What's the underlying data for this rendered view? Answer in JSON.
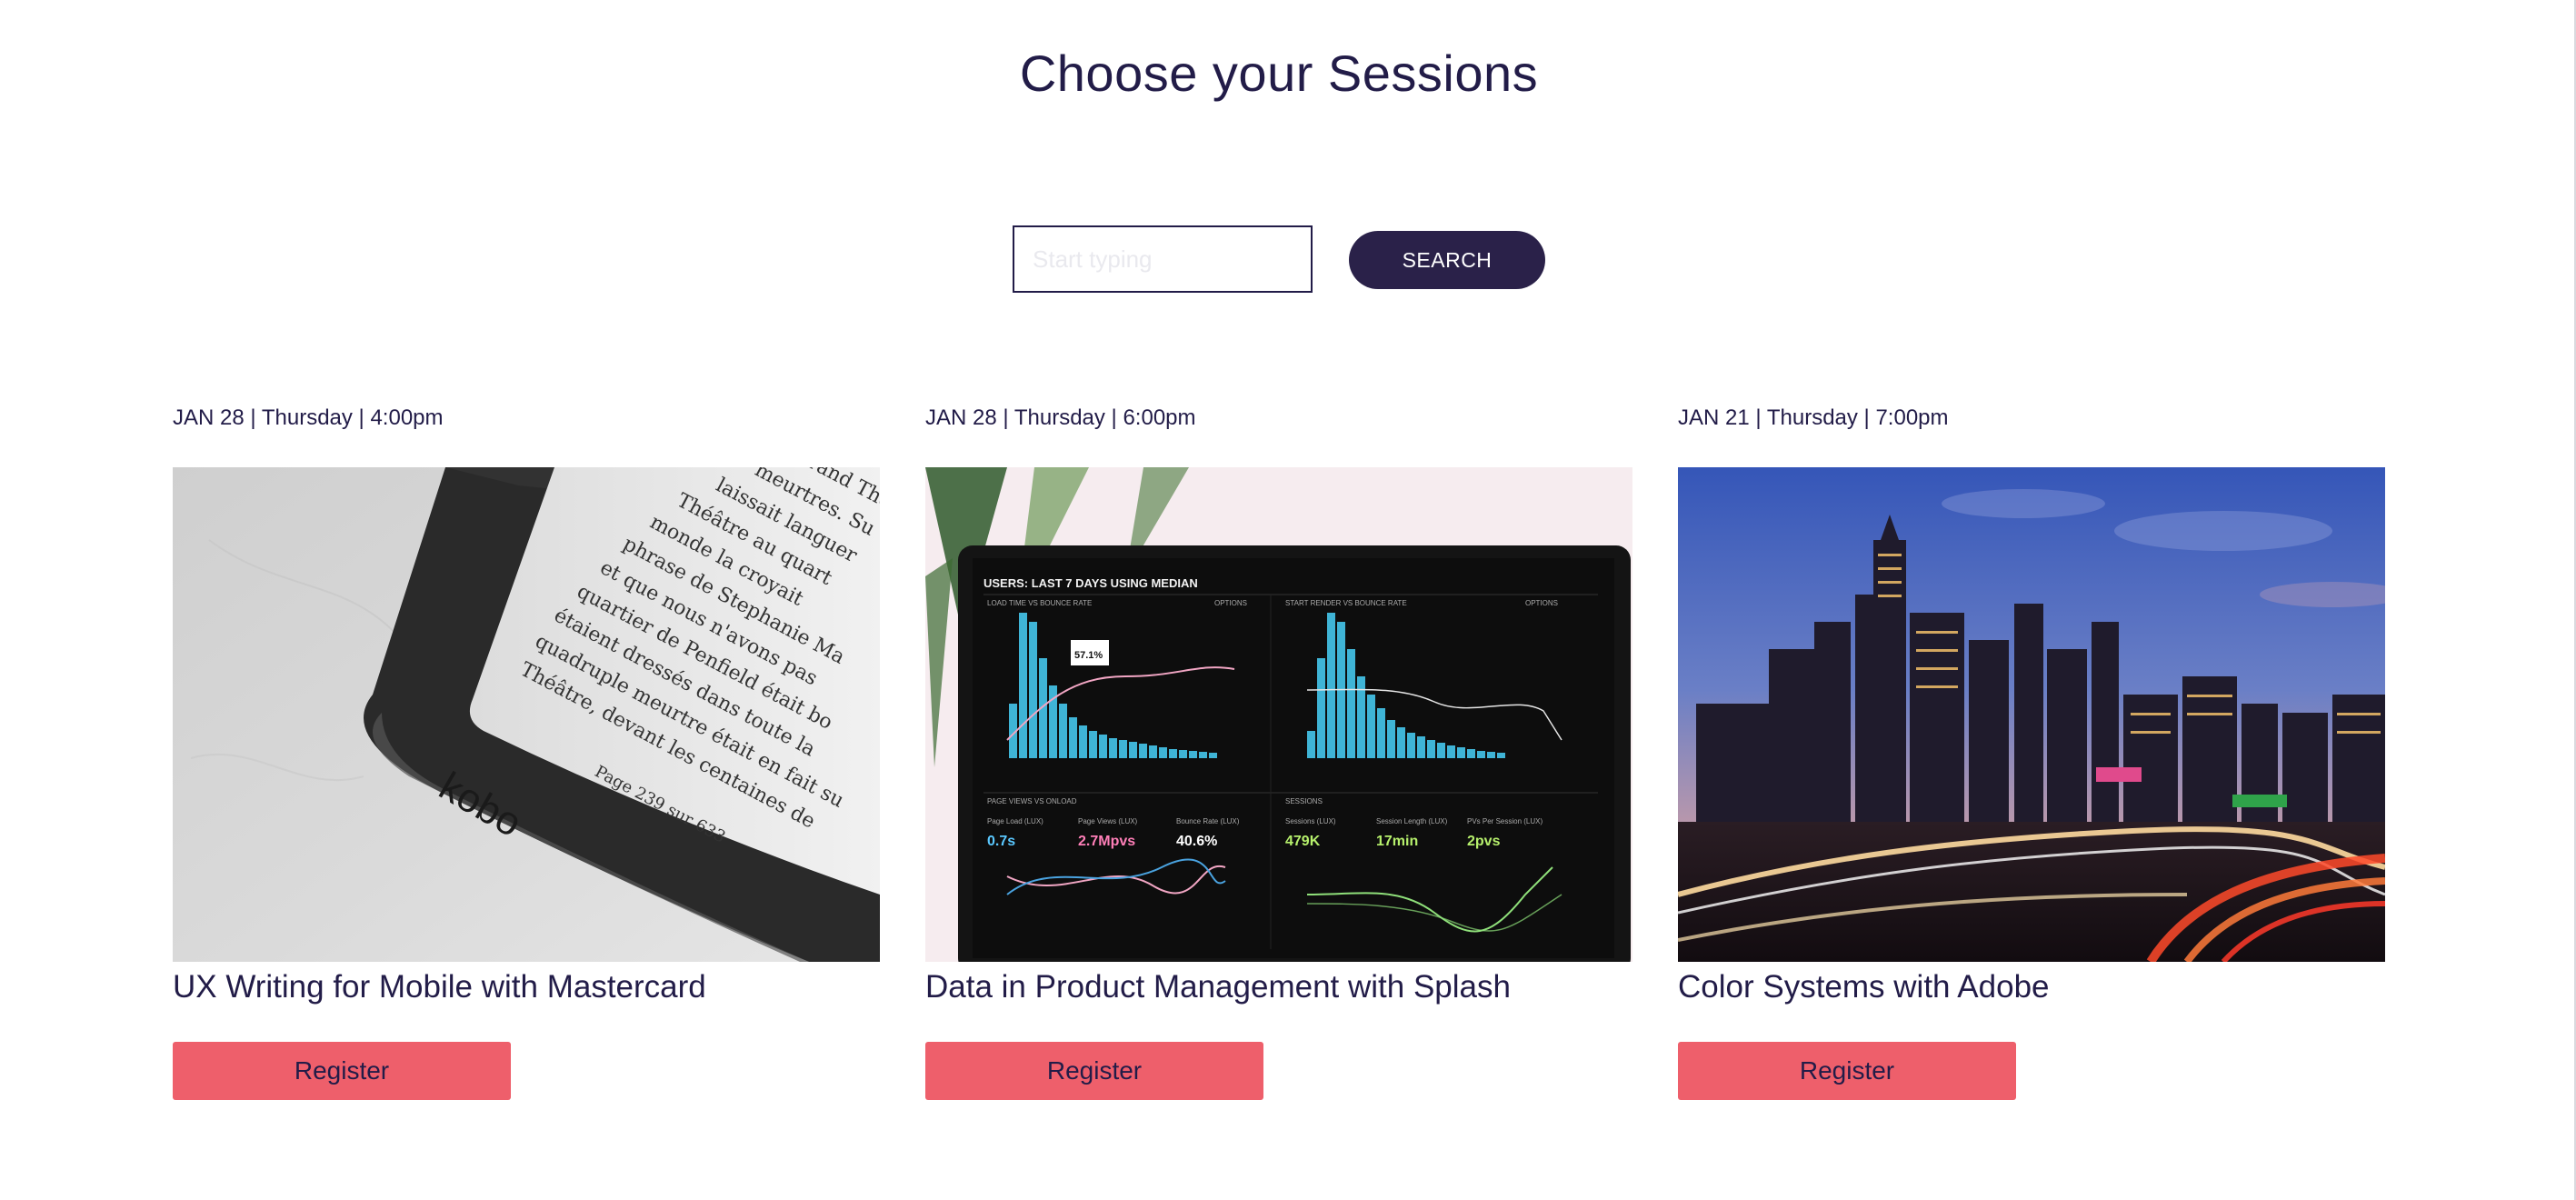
{
  "page": {
    "title": "Choose your Sessions"
  },
  "search": {
    "placeholder": "Start typing",
    "button_label": "SEARCH"
  },
  "sessions": [
    {
      "date": "JAN 28 | Thursday | 4:00pm",
      "title": "UX Writing for Mobile with Mastercard",
      "register_label": "Register",
      "image": {
        "subject": "ereader",
        "page_text": [
          "Grand Thé",
          "meurtres. Su",
          "laissait languer",
          "Théâtre au quart",
          "monde la croyait",
          "phrase de Stephanie Ma",
          "et que nous n'avons pas",
          "quartier de Penfield était bo",
          "étaient dressés dans toute la",
          "quadruple meurtre était en fait su",
          "Théâtre, devant les centaines de",
          "Page 239 sur 633"
        ],
        "brand": "kobo"
      }
    },
    {
      "date": "JAN 28 | Thursday | 6:00pm",
      "title": "Data in Product Management with Splash",
      "register_label": "Register",
      "image": {
        "subject": "analytics-dashboard",
        "header": "USERS: LAST 7 DAYS USING MEDIAN",
        "panel_titles": [
          "LOAD TIME VS BOUNCE RATE",
          "START RENDER VS BOUNCE RATE",
          "PAGE VIEWS VS ONLOAD",
          "SESSIONS"
        ],
        "options_label": "OPTIONS",
        "tooltip_value": "57.1%",
        "metric_labels": [
          "Page Load (LUX)",
          "Page Views (LUX)",
          "Bounce Rate (LUX)",
          "Sessions (LUX)",
          "Session Length (LUX)",
          "PVs Per Session (LUX)"
        ],
        "metric_values": [
          "0.7s",
          "2.7Mpvs",
          "40.6%",
          "479K",
          "17min",
          "2pvs"
        ],
        "colors": {
          "bars": "#3fb4d6",
          "line": "#f2a6c4",
          "green": "#8fe07a",
          "value_blue": "#5ac8ff",
          "value_pink": "#ff7fb8",
          "value_green": "#b6f06c"
        }
      }
    },
    {
      "date": "JAN 21 | Thursday | 7:00pm",
      "title": "Color Systems with Adobe",
      "register_label": "Register",
      "image": {
        "subject": "city-skyline-at-dusk"
      }
    }
  ],
  "colors": {
    "primary": "#221c48",
    "search_button": "#2a2149",
    "register_button": "#ee5f6b"
  }
}
